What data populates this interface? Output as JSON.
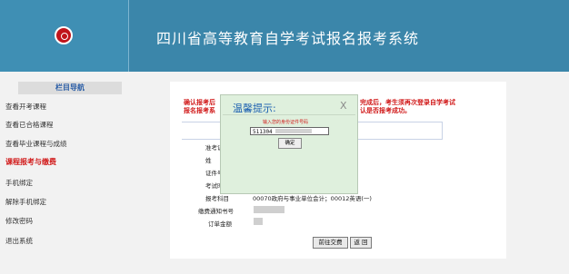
{
  "header": {
    "title": "四川省高等教育自学考试报名报考系统"
  },
  "sidebar": {
    "heading": "栏目导航",
    "items": [
      {
        "label": "查看开考课程"
      },
      {
        "label": "查看已合格课程"
      },
      {
        "label": "查看毕业课程与成绩"
      },
      {
        "label": "课程报考与缴费",
        "active": true
      },
      {
        "label": "手机绑定"
      },
      {
        "label": "解除手机绑定"
      },
      {
        "label": "修改密码"
      },
      {
        "label": "退出系统"
      }
    ]
  },
  "notice": {
    "left_line1": "确认报考后",
    "left_line2": "报名报考系",
    "right_line1": "完成后，考生须再次登录自学考试",
    "right_line2": "认是否报考成功。"
  },
  "form": {
    "rows": [
      {
        "label": "准考证"
      },
      {
        "label": "姓"
      },
      {
        "label": "证件号"
      },
      {
        "label": "考试时"
      },
      {
        "label": "报考科目",
        "value": "00070政府与事业单位会计；00012英语(一)"
      },
      {
        "label": "缴费通知书号"
      },
      {
        "label": "订单金额"
      }
    ],
    "buttons": {
      "pay": "前往交费",
      "back": "返 回"
    }
  },
  "modal": {
    "title": "温馨提示:",
    "close": "X",
    "prompt": "输入您的身份证件号码",
    "input_value": "511304",
    "confirm": "确定"
  },
  "colors": {
    "header_bg": "#3b86aa",
    "notice_red": "#d11a1a",
    "modal_bg": "#dff0dd"
  }
}
